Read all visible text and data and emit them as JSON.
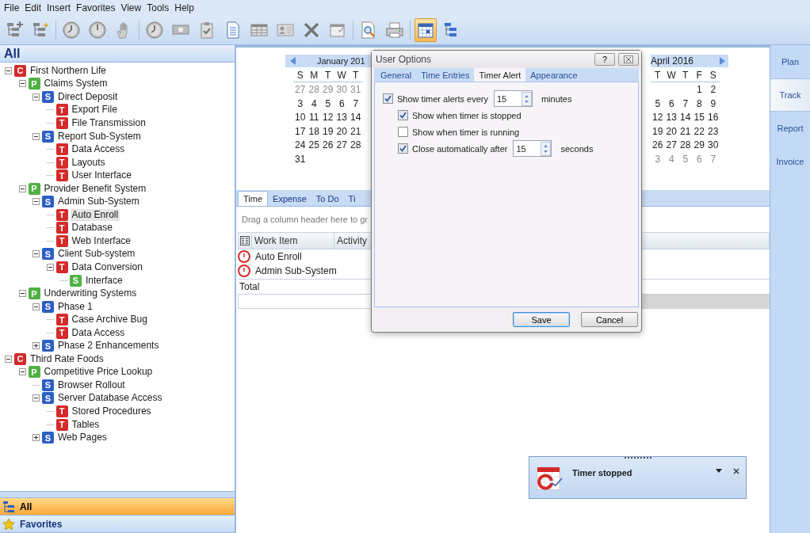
{
  "menu": [
    "File",
    "Edit",
    "Insert",
    "Favorites",
    "View",
    "Tools",
    "Help"
  ],
  "toolbar": [
    {
      "kind": "tree-add",
      "selected": false
    },
    {
      "kind": "tree-new",
      "selected": false
    },
    {
      "kind": "separator"
    },
    {
      "kind": "clock",
      "selected": false
    },
    {
      "kind": "clock-stop",
      "selected": false
    },
    {
      "kind": "hand",
      "selected": false
    },
    {
      "kind": "separator"
    },
    {
      "kind": "clock",
      "selected": false
    },
    {
      "kind": "money",
      "selected": false
    },
    {
      "kind": "clipboard",
      "selected": false
    },
    {
      "kind": "document",
      "selected": false
    },
    {
      "kind": "table",
      "selected": false
    },
    {
      "kind": "card",
      "selected": false
    },
    {
      "kind": "delete",
      "selected": false
    },
    {
      "kind": "window-check",
      "selected": false
    },
    {
      "kind": "separator"
    },
    {
      "kind": "preview",
      "selected": false
    },
    {
      "kind": "printer",
      "selected": false
    },
    {
      "kind": "separator"
    },
    {
      "kind": "calendar",
      "selected": true
    },
    {
      "kind": "tree-list",
      "selected": false
    }
  ],
  "sidebar": {
    "title": "All",
    "tree": [
      {
        "badge": "C",
        "color": "#d42a2a",
        "label": "First Northern Life",
        "expanded": true,
        "selected": false,
        "children": [
          {
            "badge": "P",
            "color": "#4fb142",
            "label": "Claims System",
            "expanded": true,
            "selected": false,
            "children": [
              {
                "badge": "S",
                "color": "#2c5fc4",
                "label": "Direct Deposit",
                "expanded": true,
                "selected": false,
                "children": [
                  {
                    "badge": "T",
                    "color": "#d42a2a",
                    "label": "Export File",
                    "selected": false
                  },
                  {
                    "badge": "T",
                    "color": "#d42a2a",
                    "label": "File Transmission",
                    "selected": false
                  }
                ]
              },
              {
                "badge": "S",
                "color": "#2c5fc4",
                "label": "Report Sub-System",
                "expanded": true,
                "selected": false,
                "children": [
                  {
                    "badge": "T",
                    "color": "#d42a2a",
                    "label": "Data Access",
                    "selected": false
                  },
                  {
                    "badge": "T",
                    "color": "#d42a2a",
                    "label": "Layouts",
                    "selected": false
                  },
                  {
                    "badge": "T",
                    "color": "#d42a2a",
                    "label": "User Interface",
                    "selected": false
                  }
                ]
              }
            ]
          },
          {
            "badge": "P",
            "color": "#4fb142",
            "label": "Provider Benefit System",
            "expanded": true,
            "selected": false,
            "children": [
              {
                "badge": "S",
                "color": "#2c5fc4",
                "label": "Admin Sub-System",
                "expanded": true,
                "selected": false,
                "children": [
                  {
                    "badge": "T",
                    "color": "#d42a2a",
                    "label": "Auto Enroll",
                    "selected": true
                  },
                  {
                    "badge": "T",
                    "color": "#d42a2a",
                    "label": "Database",
                    "selected": false
                  },
                  {
                    "badge": "T",
                    "color": "#d42a2a",
                    "label": "Web Interface",
                    "selected": false
                  }
                ]
              },
              {
                "badge": "S",
                "color": "#2c5fc4",
                "label": "Client Sub-system",
                "expanded": true,
                "selected": false,
                "children": [
                  {
                    "badge": "T",
                    "color": "#d42a2a",
                    "label": "Data Conversion",
                    "expanded": true,
                    "selected": false,
                    "children": [
                      {
                        "badge": "S",
                        "color": "#4fb142",
                        "label": "Interface",
                        "selected": false
                      }
                    ]
                  }
                ]
              }
            ]
          },
          {
            "badge": "P",
            "color": "#4fb142",
            "label": "Underwriting Systems",
            "expanded": true,
            "selected": false,
            "children": [
              {
                "badge": "S",
                "color": "#2c5fc4",
                "label": "Phase 1",
                "expanded": true,
                "selected": false,
                "children": [
                  {
                    "badge": "T",
                    "color": "#d42a2a",
                    "label": "Case Archive Bug",
                    "selected": false
                  },
                  {
                    "badge": "T",
                    "color": "#d42a2a",
                    "label": "Data Access",
                    "selected": false
                  }
                ]
              },
              {
                "badge": "S",
                "color": "#2c5fc4",
                "label": "Phase 2 Enhancements",
                "expanded": false,
                "selected": false
              }
            ]
          }
        ]
      },
      {
        "badge": "C",
        "color": "#d42a2a",
        "label": "Third Rate Foods",
        "expanded": true,
        "selected": false,
        "children": [
          {
            "badge": "P",
            "color": "#4fb142",
            "label": "Competitive Price Lookup",
            "expanded": true,
            "selected": false,
            "children": [
              {
                "badge": "S",
                "color": "#2c5fc4",
                "label": "Browser Rollout",
                "selected": false
              },
              {
                "badge": "S",
                "color": "#2c5fc4",
                "label": "Server Database Access",
                "expanded": true,
                "selected": false,
                "children": [
                  {
                    "badge": "T",
                    "color": "#d42a2a",
                    "label": "Stored Procedures",
                    "selected": false
                  },
                  {
                    "badge": "T",
                    "color": "#d42a2a",
                    "label": "Tables",
                    "selected": false
                  }
                ]
              },
              {
                "badge": "S",
                "color": "#2c5fc4",
                "label": "Web Pages",
                "expanded": false,
                "selected": false
              }
            ]
          }
        ]
      }
    ],
    "nav": [
      {
        "label": "All",
        "kind": "tree",
        "selected": true
      },
      {
        "label": "Favorites",
        "kind": "star",
        "selected": false
      }
    ]
  },
  "calendars": [
    {
      "title": "January 201",
      "weekdays": [
        "S",
        "M",
        "T",
        "W",
        "T"
      ],
      "weeks": [
        {
          "days": [
            "27",
            "28",
            "29",
            "30",
            "31"
          ],
          "muted": true
        },
        {
          "days": [
            "3",
            "4",
            "5",
            "6",
            "7"
          ],
          "muted": false
        },
        {
          "days": [
            "10",
            "11",
            "12",
            "13",
            "14"
          ],
          "muted": false
        },
        {
          "days": [
            "17",
            "18",
            "19",
            "20",
            "21"
          ],
          "muted": false
        },
        {
          "days": [
            "24",
            "25",
            "26",
            "27",
            "28"
          ],
          "muted": false
        },
        {
          "days": [
            "31"
          ],
          "muted": false
        }
      ]
    },
    {
      "title": "April 2016",
      "weekdays": [
        "T",
        "W",
        "T",
        "F",
        "S"
      ],
      "weeks": [
        {
          "days": [
            "1",
            "2"
          ],
          "muted": false
        },
        {
          "days": [
            "5",
            "6",
            "7",
            "8",
            "9"
          ],
          "muted": false
        },
        {
          "days": [
            "12",
            "13",
            "14",
            "15",
            "16"
          ],
          "muted": false
        },
        {
          "days": [
            "19",
            "20",
            "21",
            "22",
            "23"
          ],
          "muted": false
        },
        {
          "days": [
            "26",
            "27",
            "28",
            "29",
            "30"
          ],
          "muted": false
        },
        {
          "days": [
            "3",
            "4",
            "5",
            "6",
            "7"
          ],
          "muted": true
        }
      ]
    }
  ],
  "entry_tabs": [
    {
      "label": "Time",
      "selected": true
    },
    {
      "label": "Expense",
      "selected": false
    },
    {
      "label": "To Do",
      "selected": false
    },
    {
      "label": "Ti",
      "selected": false
    }
  ],
  "group_hint": "Drag a column header here to gr",
  "grid": {
    "columns": [
      "Work Item",
      "Activity"
    ],
    "rows": [
      {
        "work_item": "Auto Enroll"
      },
      {
        "work_item": "Admin Sub-System"
      }
    ],
    "total_label": "Total"
  },
  "side_tabs": [
    {
      "label": "Plan",
      "selected": false
    },
    {
      "label": "Track",
      "selected": true
    },
    {
      "label": "Report",
      "selected": false
    },
    {
      "label": "Invoice",
      "selected": false
    }
  ],
  "dialog": {
    "title": "User Options",
    "help": "?",
    "tabs": [
      {
        "label": "General",
        "selected": false
      },
      {
        "label": "Time Entries",
        "selected": false
      },
      {
        "label": "Timer Alert",
        "selected": true
      },
      {
        "label": "Appearance",
        "selected": false
      }
    ],
    "options": [
      {
        "label": "Show timer alerts every",
        "checked": true,
        "value": "15",
        "unit": "minutes",
        "children": [
          {
            "label": "Show when timer is stopped",
            "checked": true
          },
          {
            "label": "Show when timer is running",
            "checked": false
          },
          {
            "label": "Close automatically after",
            "checked": true,
            "value": "15",
            "unit": "seconds"
          }
        ]
      }
    ],
    "buttons": [
      {
        "label": "Save",
        "default": true
      },
      {
        "label": "Cancel",
        "default": false
      }
    ]
  },
  "toast": {
    "message": "Timer stopped"
  }
}
